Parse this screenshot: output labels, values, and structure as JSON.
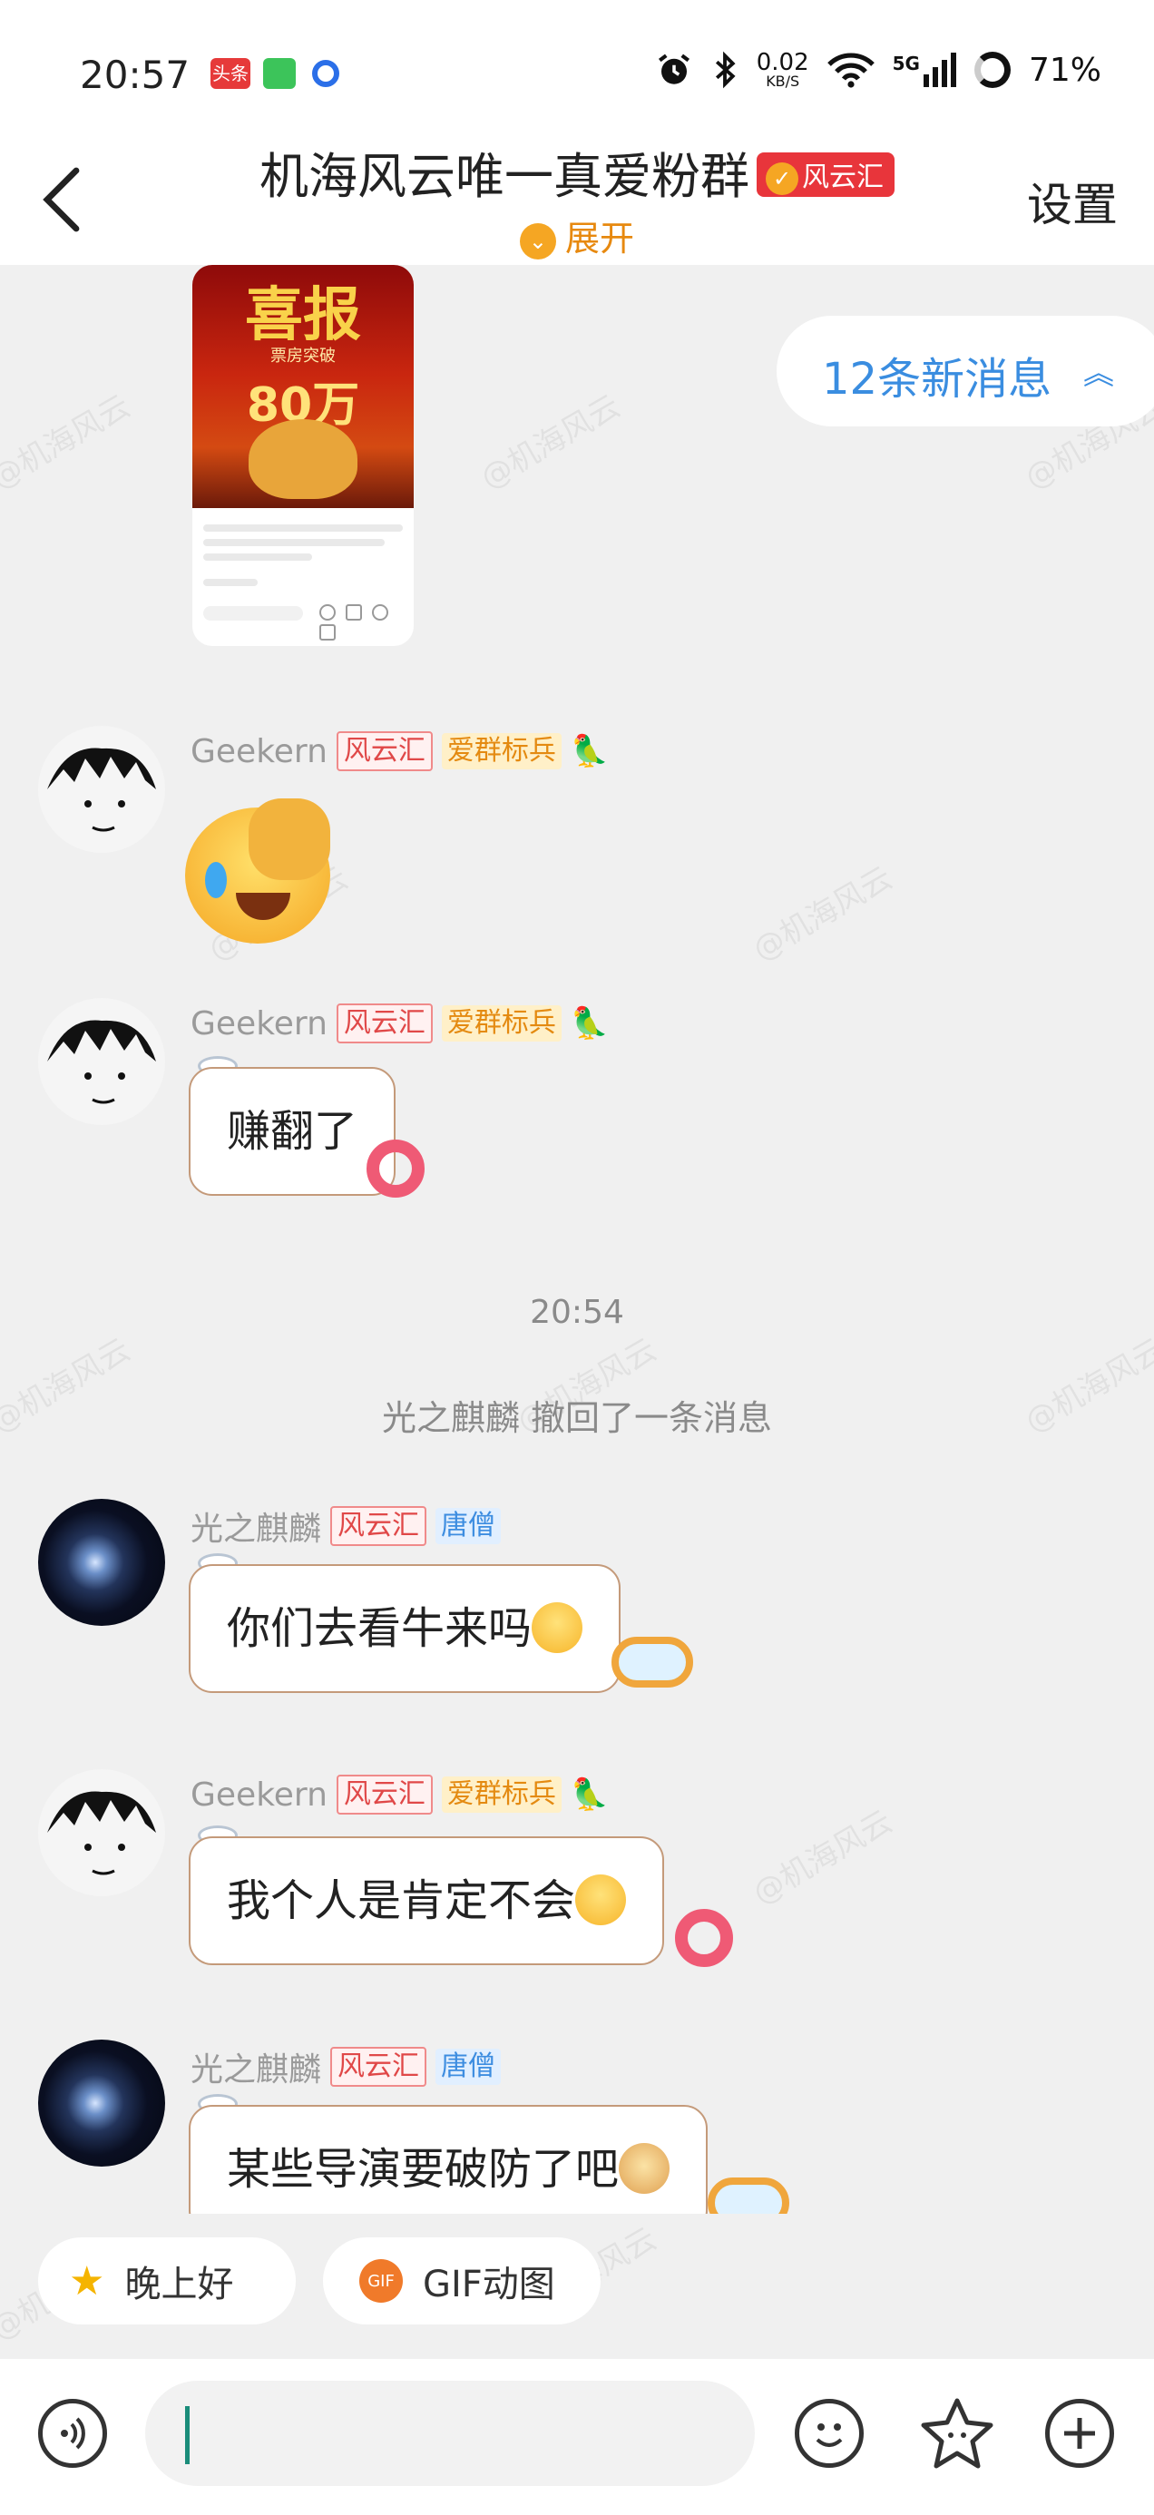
{
  "status_bar": {
    "time": "20:57",
    "app_icons": [
      "头条",
      "wechat-green-icon",
      "blue-circle-icon"
    ],
    "speed_value": "0.02",
    "speed_unit": "KB/S",
    "network": "5G",
    "battery": "71%"
  },
  "header": {
    "title": "机海风云唯一真爱粉群",
    "title_badge": "风云汇",
    "expand_label": "展开",
    "settings_label": "设置"
  },
  "new_messages_label": "12条新消息",
  "shared_poster": {
    "headline": "喜报",
    "subline": "票房突破",
    "number": "80万"
  },
  "messages": [
    {
      "sender": "Geekern",
      "badges": [
        "风云汇",
        "爱群标兵"
      ],
      "type": "sticker",
      "content": "facepalm-laugh-sticker"
    },
    {
      "sender": "Geekern",
      "badges": [
        "风云汇",
        "爱群标兵"
      ],
      "type": "text",
      "content": "赚翻了"
    },
    {
      "type": "time",
      "content": "20:54"
    },
    {
      "type": "system",
      "content": "光之麒麟 撤回了一条消息"
    },
    {
      "sender": "光之麒麟",
      "badges": [
        "风云汇",
        "唐僧"
      ],
      "type": "text",
      "content": "你们去看牛来吗"
    },
    {
      "sender": "Geekern",
      "badges": [
        "风云汇",
        "爱群标兵"
      ],
      "type": "text",
      "content": "我个人是肯定不会"
    },
    {
      "sender": "光之麒麟",
      "badges": [
        "风云汇",
        "唐僧"
      ],
      "type": "text",
      "content": "某些导演要破防了吧"
    }
  ],
  "quick_replies": [
    "晚上好",
    "GIF动图"
  ],
  "quick_reply_icons": [
    "star-icon",
    "GIF"
  ],
  "input": {
    "placeholder": ""
  },
  "watermark": "@机海风云",
  "colors": {
    "accent_orange": "#f5a623",
    "link_blue": "#3a8de0",
    "badge_red": "#e04848"
  }
}
